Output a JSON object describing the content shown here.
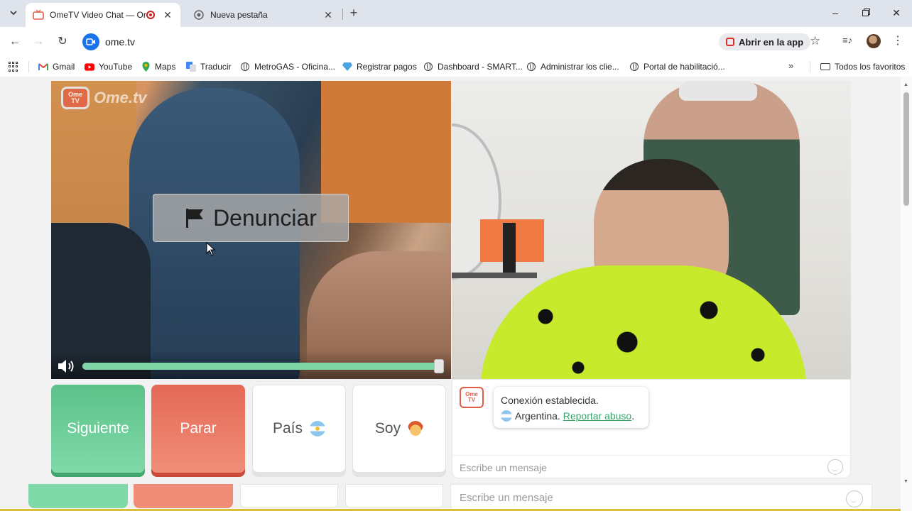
{
  "browser": {
    "tabs": [
      {
        "title": "OmeTV Video Chat — Ome",
        "active": true
      },
      {
        "title": "Nueva pestaña",
        "active": false
      }
    ],
    "url": "ome.tv",
    "open_in_app": "Abrir en la app",
    "bookmarks": [
      {
        "label": "Gmail",
        "icon": "gmail-icon"
      },
      {
        "label": "YouTube",
        "icon": "youtube-icon"
      },
      {
        "label": "Maps",
        "icon": "maps-icon"
      },
      {
        "label": "Traducir",
        "icon": "translate-icon"
      },
      {
        "label": "MetroGAS - Oficina...",
        "icon": "globe-icon"
      },
      {
        "label": "Registrar pagos",
        "icon": "diamond-icon"
      },
      {
        "label": "Dashboard - SMART...",
        "icon": "globe-icon"
      },
      {
        "label": "Administrar los clie...",
        "icon": "globe-icon"
      },
      {
        "label": "Portal de habilitació...",
        "icon": "globe-icon"
      }
    ],
    "all_bookmarks": "Todos los favoritos"
  },
  "site": {
    "logo_text": "Ome.tv",
    "logo_badge": [
      "Ome",
      "TV"
    ],
    "report_label": "Denunciar",
    "volume_level": 1.0,
    "buttons": {
      "next": "Siguiente",
      "stop": "Parar",
      "country": "País",
      "gender": "Soy"
    },
    "chat": {
      "system_line1": "Conexión establecida.",
      "country": "Argentina.",
      "report_link": "Reportar abuso",
      "report_suffix": ".",
      "placeholder": "Escribe un mensaje"
    }
  },
  "colors": {
    "next": "#5dc28a",
    "stop": "#e46a56",
    "link": "#3aa56d",
    "volume_fill": "#7fd6a6"
  }
}
